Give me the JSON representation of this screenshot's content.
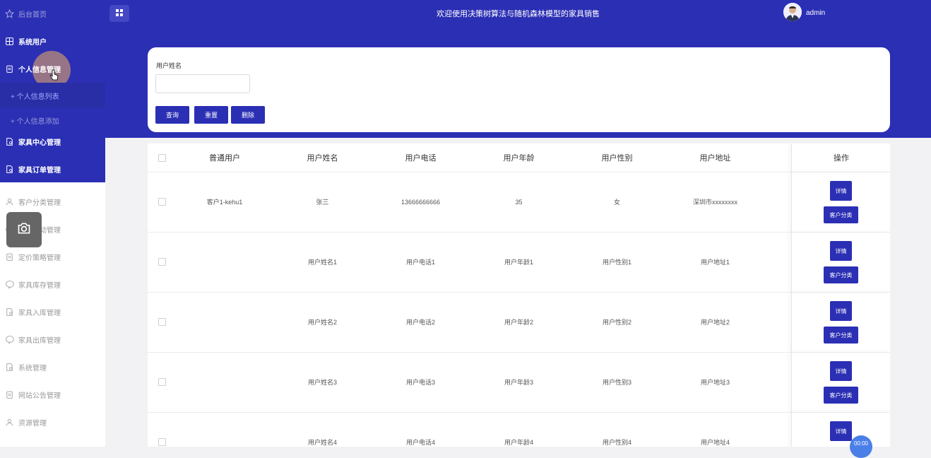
{
  "header": {
    "title": "欢迎使用决策树算法与随机森林模型的家具销售",
    "username": "admin"
  },
  "sidebar": {
    "items": [
      {
        "label": "后台首页",
        "icon": "star-icon"
      },
      {
        "label": "系统用户",
        "icon": "grid-icon"
      },
      {
        "label": "个人信息管理",
        "icon": "clipboard-icon"
      },
      {
        "label": "家具中心管理",
        "icon": "document-icon"
      },
      {
        "label": "家具订单管理",
        "icon": "document-icon"
      },
      {
        "label": "客户分类管理",
        "icon": "user-icon"
      },
      {
        "label": "家…活动管理",
        "icon": "info-icon"
      },
      {
        "label": "定价策略管理",
        "icon": "clipboard-icon"
      },
      {
        "label": "家具库存管理",
        "icon": "chat-icon"
      },
      {
        "label": "家具入库管理",
        "icon": "document-icon"
      },
      {
        "label": "家具出库管理",
        "icon": "chat-icon"
      },
      {
        "label": "系统管理",
        "icon": "document-icon"
      },
      {
        "label": "网站公告管理",
        "icon": "clipboard-icon"
      },
      {
        "label": "资源管理",
        "icon": "user-icon"
      }
    ],
    "subitems": [
      {
        "label": "+ 个人信息列表"
      },
      {
        "label": "+ 个人信息添加"
      }
    ]
  },
  "search": {
    "field_label": "用户姓名",
    "input_value": "",
    "buttons": {
      "query": "查询",
      "reset": "重置",
      "delete": "删除"
    }
  },
  "table": {
    "columns": [
      "普通用户",
      "用户姓名",
      "用户电话",
      "用户年龄",
      "用户性别",
      "用户地址",
      "操作"
    ],
    "rows": [
      {
        "account": "客户1-kehu1",
        "name": "张三",
        "phone": "13666666666",
        "age": "35",
        "gender": "女",
        "address": "深圳市xxxxxxxx"
      },
      {
        "account": "",
        "name": "用户姓名1",
        "phone": "用户电话1",
        "age": "用户年龄1",
        "gender": "用户性别1",
        "address": "用户地址1"
      },
      {
        "account": "",
        "name": "用户姓名2",
        "phone": "用户电话2",
        "age": "用户年龄2",
        "gender": "用户性别2",
        "address": "用户地址2"
      },
      {
        "account": "",
        "name": "用户姓名3",
        "phone": "用户电话3",
        "age": "用户年龄3",
        "gender": "用户性别3",
        "address": "用户地址3"
      },
      {
        "account": "",
        "name": "用户姓名4",
        "phone": "用户电话4",
        "age": "用户年龄4",
        "gender": "用户性别4",
        "address": "用户地址4"
      }
    ],
    "actions": {
      "detail": "详情",
      "classify": "客户分类"
    }
  },
  "fab": {
    "label": "00:00"
  },
  "colors": {
    "primary": "#2b2fb4",
    "sidebar_light_text": "#9a9a9a",
    "background": "#f2f2f4"
  }
}
